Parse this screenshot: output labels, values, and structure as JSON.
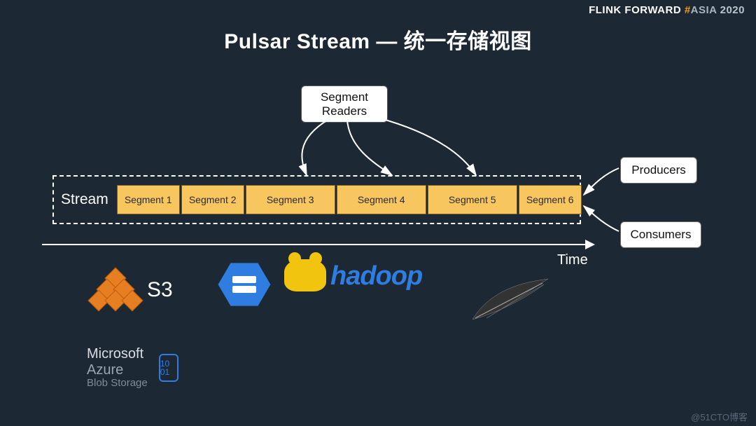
{
  "header": {
    "brand1": "FLINK  FORWARD ",
    "hash": "#",
    "brand2": "ASIA ",
    "year": "2020"
  },
  "title": "Pulsar Stream — 统一存储视图",
  "segment_readers": {
    "line1": "Segment",
    "line2": "Readers"
  },
  "stream": {
    "label": "Stream",
    "segments": [
      "Segment 1",
      "Segment 2",
      "Segment 3",
      "Segment 4",
      "Segment 5",
      "Segment 6"
    ]
  },
  "time_label": "Time",
  "producers": "Producers",
  "consumers": "Consumers",
  "logos": {
    "s3": "S3",
    "hadoop": "hadoop",
    "azure_ms": "Microsoft ",
    "azure_az": "Azure",
    "azure_sub": "Blob Storage",
    "azure_badge": "10\n01"
  },
  "watermark": "@51CTO博客"
}
